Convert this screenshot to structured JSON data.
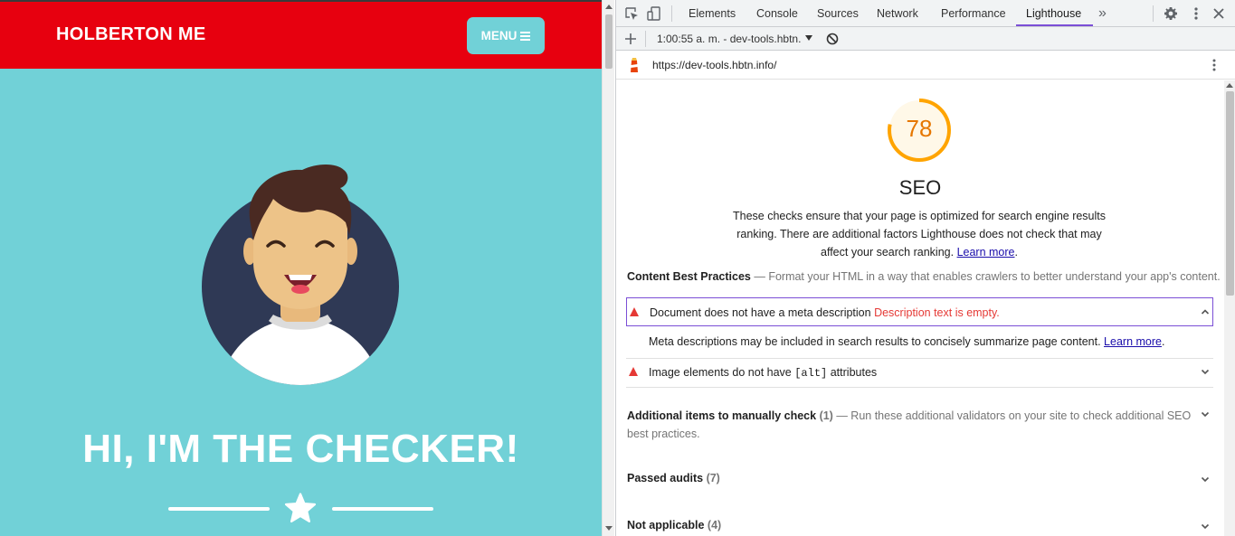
{
  "site": {
    "brand": "HOLBERTON ME",
    "menu_label": "MENU",
    "hero_title": "HI, I'M THE CHECKER!",
    "colors": {
      "nav": "#e7000f",
      "background": "#71d1d7",
      "text": "#ffffff"
    }
  },
  "devtools": {
    "tabs": [
      "Elements",
      "Console",
      "Sources",
      "Network",
      "Performance",
      "Lighthouse"
    ],
    "active_tab": "Lighthouse",
    "overflow_label": "»",
    "report_selector": "1:00:55 a. m. - dev-tools.hbtn.",
    "url": "https://dev-tools.hbtn.info/",
    "category": {
      "score": "78",
      "score_value": 0.78,
      "title": "SEO",
      "description": "These checks ensure that your page is optimized for search engine results ranking. There are additional factors Lighthouse does not check that may affect your search ranking.",
      "learn_more": "Learn more",
      "score_color": "#ffa400"
    },
    "groups": {
      "content": {
        "title": "Content Best Practices",
        "description": "— Format your HTML in a way that enables crawlers to better understand your app's content."
      },
      "manual": {
        "title": "Additional items to manually check",
        "count": "(1)",
        "description": "— Run these additional validators on your site to check additional SEO best practices."
      },
      "passed": {
        "title": "Passed audits",
        "count": "(7)"
      },
      "na": {
        "title": "Not applicable",
        "count": "(4)"
      }
    },
    "audits": {
      "meta": {
        "title": "Document does not have a meta description",
        "display_value": "Description text is empty.",
        "detail": "Meta descriptions may be included in search results to concisely summarize page content.",
        "learn_more": "Learn more"
      },
      "alt": {
        "title_pre": "Image elements do not have",
        "code": "[alt]",
        "title_post": "attributes"
      }
    }
  }
}
